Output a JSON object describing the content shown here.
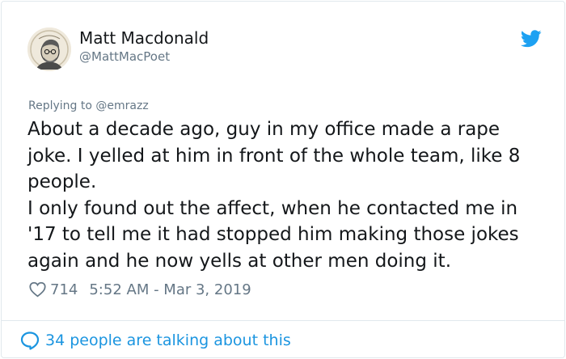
{
  "author": {
    "name": "Matt Macdonald",
    "handle": "@MattMacPoet"
  },
  "reply_to": "Replying to @emrazz",
  "tweet_lines": [
    "About a decade ago, guy in my office made a rape",
    "joke. I yelled at him in front of the whole team, like 8",
    "people.",
    "I only found out the affect, when he contacted me in",
    "'17 to tell me it had stopped him making those jokes",
    "again and he now yells at other men doing it."
  ],
  "likes": "714",
  "timestamp": "5:52 AM - Mar 3, 2019",
  "footer": "34 people are talking about this",
  "icons": {
    "brand": "twitter-bird-icon",
    "like": "heart-icon",
    "conversation": "speech-bubble-icon"
  },
  "colors": {
    "accent": "#1da1f2",
    "link": "#1b95e0",
    "muted": "#657786",
    "text": "#14171a"
  }
}
